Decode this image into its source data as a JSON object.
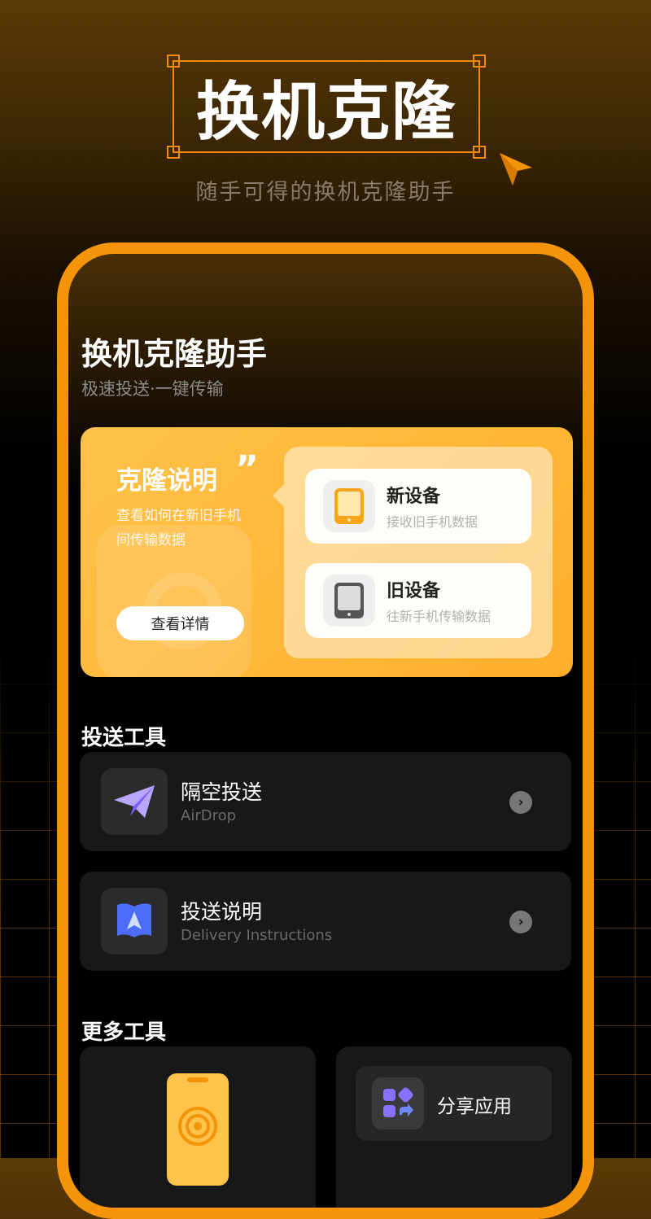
{
  "hero": {
    "title": "换机克隆",
    "subtitle": "随手可得的换机克隆助手",
    "accent_color": "#f59408"
  },
  "app": {
    "title": "换机克隆助手",
    "subtitle": "极速投送·一键传输"
  },
  "banner": {
    "title": "克隆说明",
    "quote_mark": "”",
    "description": "查看如何在新旧手机间传输数据",
    "details_button": "查看详情",
    "devices": [
      {
        "name": "新设备",
        "desc": "接收旧手机数据",
        "icon": "tablet-orange-icon"
      },
      {
        "name": "旧设备",
        "desc": "往新手机传输数据",
        "icon": "tablet-gray-icon"
      }
    ]
  },
  "delivery_tools": {
    "section_title": "投送工具",
    "items": [
      {
        "name": "隔空投送",
        "sub": "AirDrop",
        "icon": "paper-plane-icon"
      },
      {
        "name": "投送说明",
        "sub": "Delivery Instructions",
        "icon": "book-icon"
      }
    ]
  },
  "more_tools": {
    "section_title": "更多工具",
    "share_label": "分享应用"
  }
}
